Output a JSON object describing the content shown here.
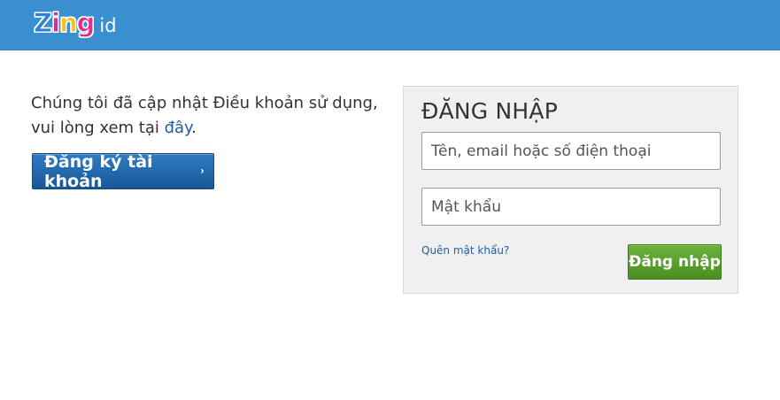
{
  "header": {
    "logo_letters": [
      "Z",
      "i",
      "n",
      "g"
    ],
    "logo_colors": [
      "#2e7fd6",
      "#e12b8c",
      "#f6c21b",
      "#e12b8c"
    ],
    "logo_suffix": "id",
    "bar_color": "#3a8fd1"
  },
  "notice": {
    "text": "Chúng tôi đã cập nhật Điều khoản sử dụng, vui lòng xem tại ",
    "link": "đây",
    "suffix": "."
  },
  "register": {
    "label": "Đăng ký tài khoản",
    "chevron": "›"
  },
  "login": {
    "title": "ĐĂNG NHẬP",
    "username_placeholder": "Tên, email hoặc số điện thoại",
    "username_value": "",
    "password_placeholder": "Mật khẩu",
    "password_value": "",
    "forgot_label": "Quên mật khẩu?",
    "submit_label": "Đăng nhập"
  }
}
